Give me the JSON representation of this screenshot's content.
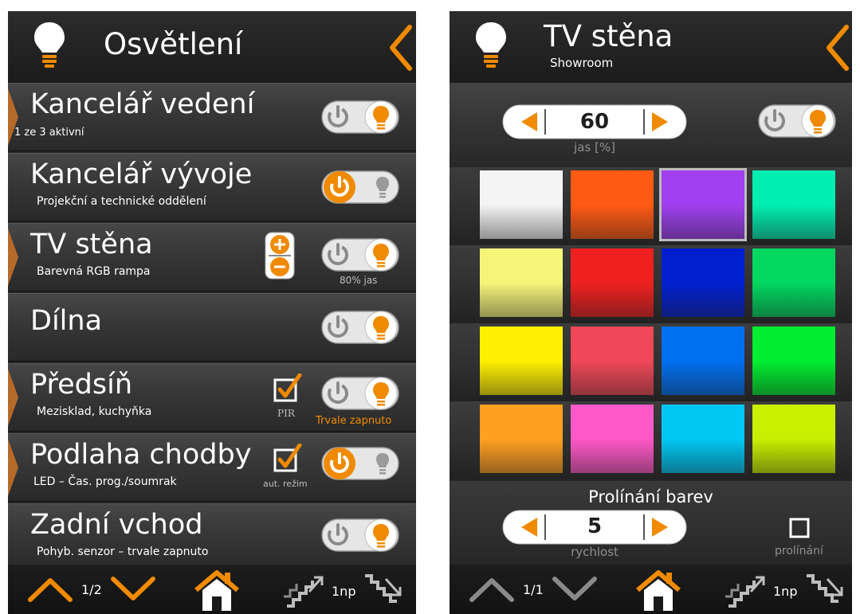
{
  "left": {
    "header": {
      "title": "Osvětlení"
    },
    "rows": [
      {
        "title": "Kancelář vedení",
        "subtitle": "1 ze 3 aktivní",
        "state": "on"
      },
      {
        "title": "Kancelář vývoje",
        "subtitle": "Projekční a technické oddělení",
        "state": "off"
      },
      {
        "title": "TV stěna",
        "subtitle": "Barevná RGB rampa",
        "state": "on",
        "note": "80% jas"
      },
      {
        "title": "Dílna",
        "subtitle": "",
        "state": "on"
      },
      {
        "title": "Předsíň",
        "subtitle": "Mezisklad, kuchyňka",
        "state": "on",
        "check_label": "PIR",
        "note": "Trvale zapnuto"
      },
      {
        "title": "Podlaha chodby",
        "subtitle": "LED – Čas. prog./soumrak",
        "state": "off",
        "check_label": "aut. režim"
      },
      {
        "title": "Zadní vchod",
        "subtitle": "Pohyb. senzor – trvale zapnuto",
        "state": "on"
      }
    ],
    "footer": {
      "page": "1/2",
      "floor": "1np"
    }
  },
  "right": {
    "header": {
      "title": "TV stěna",
      "subtitle": "Showroom"
    },
    "brightness": {
      "value": "60",
      "label": "jas [%]",
      "state": "on"
    },
    "swatches": [
      [
        "#f4f4f4",
        "#ff5a14",
        "#a040f0",
        "#00eeb0"
      ],
      [
        "#f6f47a",
        "#f02020",
        "#0020d0",
        "#00d860"
      ],
      [
        "#fff000",
        "#f04858",
        "#0070f0",
        "#00ee30"
      ],
      [
        "#ffa020",
        "#ff58c8",
        "#00c8f4",
        "#c8f000"
      ]
    ],
    "selected_swatch": "#a040f0",
    "blend": {
      "title": "Prolínání barev",
      "value": "5",
      "speed_label": "rychlost",
      "checkbox_label": "prolínání"
    },
    "footer": {
      "page": "1/1",
      "floor": "1np"
    }
  },
  "colors": {
    "accent": "#f08a00",
    "background": "#262626"
  },
  "icons": [
    "bulb-icon",
    "back-chevron-icon",
    "power-icon",
    "up-chevron-icon",
    "down-chevron-icon",
    "home-icon",
    "stairs-up-icon",
    "stairs-down-icon",
    "plus-minus-icon",
    "checkbox-icon"
  ]
}
